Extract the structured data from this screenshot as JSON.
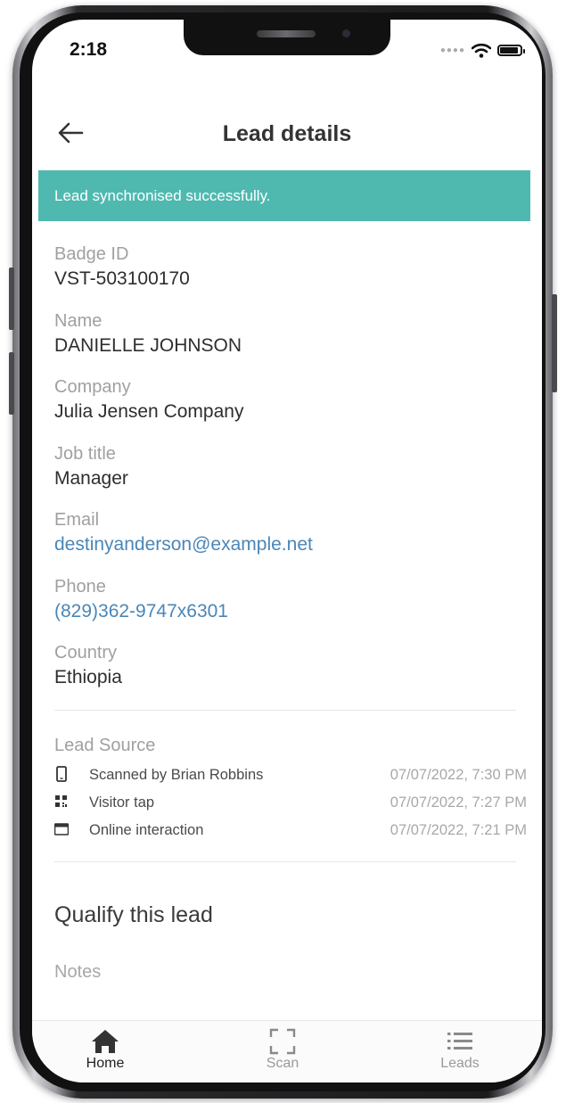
{
  "status_bar": {
    "time": "2:18"
  },
  "header": {
    "title": "Lead details"
  },
  "banner": {
    "message": "Lead synchronised successfully."
  },
  "fields": [
    {
      "label": "Badge ID",
      "value": "VST-503100170"
    },
    {
      "label": "Name",
      "value": "DANIELLE JOHNSON"
    },
    {
      "label": "Company",
      "value": "Julia Jensen Company"
    },
    {
      "label": "Job title",
      "value": "Manager"
    },
    {
      "label": "Email",
      "value": "destinyanderson@example.net"
    },
    {
      "label": "Phone",
      "value": "(829)362-9747x6301"
    },
    {
      "label": "Country",
      "value": "Ethiopia"
    }
  ],
  "lead_source": {
    "label": "Lead Source",
    "items": [
      {
        "icon": "phone-icon",
        "text": "Scanned by Brian Robbins",
        "timestamp": "07/07/2022, 7:30 PM"
      },
      {
        "icon": "qr-code-icon",
        "text": "Visitor tap",
        "timestamp": "07/07/2022, 7:27 PM"
      },
      {
        "icon": "browser-window-icon",
        "text": "Online interaction",
        "timestamp": "07/07/2022, 7:21 PM"
      }
    ]
  },
  "qualify": {
    "title": "Qualify this lead",
    "notes_label": "Notes"
  },
  "tabbar": {
    "home": "Home",
    "scan": "Scan",
    "leads": "Leads",
    "active": "Home"
  },
  "colors": {
    "banner": "#4fb9b0",
    "link": "#4a86b8",
    "label": "#a0a0a0"
  }
}
